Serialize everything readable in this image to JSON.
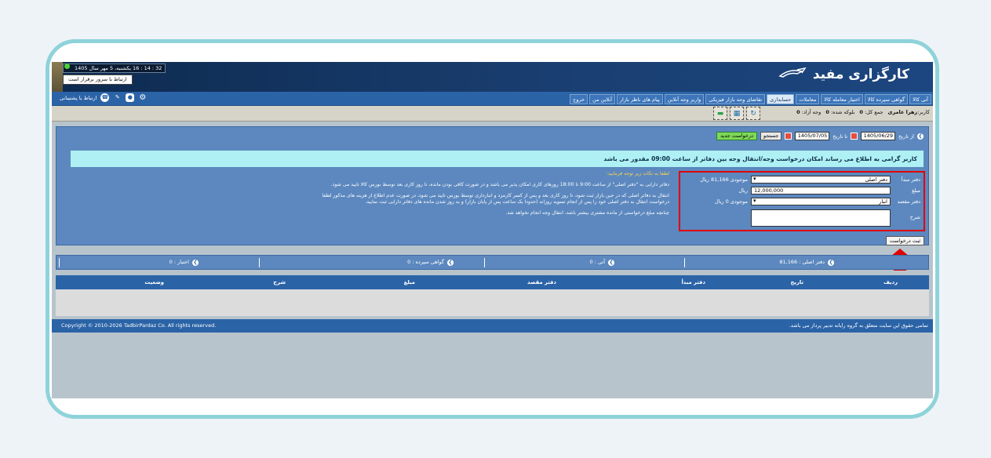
{
  "header": {
    "logo_text": "کارگزاری مفید",
    "clock_text": "32 : 14 : 16 یکشنبه، 5 مهر سال 1405",
    "connection_status": "ارتباط با سرور برقرار است"
  },
  "menu": {
    "items": [
      "آتی کالا",
      "گواهی سپرده کالا",
      "اختیار معامله کالا",
      "معاملات",
      "حسابداری",
      "تقاضای وجه بازار فیزیکی",
      "واریز وجه آنلاین",
      "پیام های ناظر بازار",
      "آنلاین من",
      "خروج"
    ],
    "active_index": 4,
    "support_label": "ارتباط با پشتیبانی"
  },
  "userbar": {
    "user_label": "کاربر:",
    "user_name": "زهرا عامری",
    "total_label": "جمع کل:",
    "total_value": "0",
    "blocked_label": "بلوکه شده:",
    "blocked_value": "0",
    "free_label": "وجه آزاد:",
    "free_value": "0"
  },
  "filter": {
    "from_label": "از تاریخ",
    "from_date": "1405/06/29",
    "to_label": "تا تاریخ",
    "to_date": "1405/07/05",
    "search_label": "جستجو",
    "new_request_label": "درخواست جدید"
  },
  "notice": "کاربر گرامی به اطلاع می رساند امکان درخواست وجه/انتقال وجه بین دفاتر از ساعت 09:00 مقدور می باشد",
  "form": {
    "source_label": "دفتر مبدأ",
    "source_value": "دفتر اصلی",
    "source_balance_label": "موجودی 81,166 ریال",
    "amount_label": "مبلغ",
    "amount_value": "12,000,000",
    "amount_unit": "ریال",
    "dest_label": "دفتر مقصد",
    "dest_value": "انبار",
    "dest_balance_label": "موجودی 0 ریال",
    "desc_label": "شرح",
    "submit_label": "ثبت درخواست"
  },
  "tips": {
    "heading": "لطفا به نکات زیر توجه فرمایید:",
    "items": [
      "دفاتر دارایی به \"دفتر اصلی\" از ساعت 9:00 تا 18:00 روزهای کاری امکان پذیر می باشد و در صورت کافی بودن مانده، تا روز کاری بعد توسط بورس کالا تایید می شود.",
      "انتقال به دفاتر اصلی که در حین بازار ثبت شود، تا روز کاری بعد و پس از کسر کارمزد و انبارداری توسط بورس تایید می شود، در صورت عدم اطلاع از هزینه های مذکور لطفا درخواست انتقال به دفتر اصلی خود را پس از انجام تسویه روزانه (حدودا یک ساعت پس از پایان بازار) و به روز شدن مانده های دفاتر دارایی ثبت نمایید.",
      "چنانچه مبلغ درخواستی از مانده مشتری بیشتر باشد، انتقال وجه انجام نخواهد شد."
    ]
  },
  "summary": {
    "main_office": "دفتر اصلی : 81,166",
    "futures": "آتی : 0",
    "deposit_cert": "گواهی سپرده : 0",
    "options": "اختیار : 0"
  },
  "table": {
    "columns": [
      "ردیف",
      "تاریخ",
      "دفتر مبدأ",
      "دفتر مقصد",
      "مبلغ",
      "شرح",
      "وضعیت"
    ]
  },
  "footer": {
    "rights": "تمامی حقوق این سایت متعلق به گروه رایانه تدبیر پرداز می باشد.",
    "copyright": "Copyright © 2010-2026 TadbirPardaz Co. All rights reserved."
  },
  "colors": {
    "header_bg": "#1a3f72",
    "menu_bg": "#2b63a7",
    "panel_bg": "#5c88bf",
    "notice_bg": "#aef0f3",
    "highlight": "#e00000",
    "frame": "#8ed3d9"
  }
}
